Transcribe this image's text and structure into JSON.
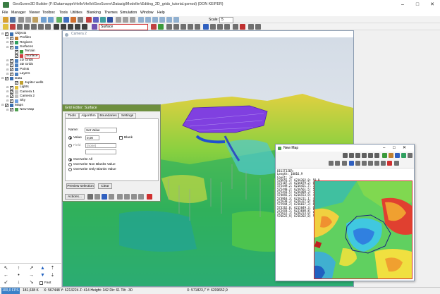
{
  "window": {
    "title": "GeoScene3D Builder (F:\\Datamappe\\Hello\\Hello\\GeoScene\\Datasig\\Modeller\\Editing_2D_grids_tutorial.gsmod) (DON KEIFER)",
    "controls": [
      "–",
      "□",
      "✕"
    ]
  },
  "menu": [
    "File",
    "Manager",
    "Viewer",
    "Toolbox",
    "Tools",
    "Utilities",
    "Blanking",
    "Themes",
    "Simulation",
    "Window",
    "Help"
  ],
  "toolbar": {
    "scale_label": "Scale:",
    "scale_value": "5",
    "surface_select": "Surface"
  },
  "tree": [
    {
      "label": "Objects",
      "level": 0,
      "checked": true,
      "icon_color": "#3a6fb0"
    },
    {
      "label": "Profiles",
      "level": 1,
      "checked": true,
      "icon_color": "#c08030"
    },
    {
      "label": "Regions",
      "level": 1,
      "checked": true,
      "icon_color": "#30a060"
    },
    {
      "label": "Surfaces",
      "level": 1,
      "checked": true,
      "icon_color": "#4a80c0"
    },
    {
      "label": "Terrain",
      "level": 2,
      "checked": true,
      "icon_color": "#3a9a3a"
    },
    {
      "label": "Surface",
      "level": 2,
      "checked": true,
      "icon_color": "#d04040",
      "highlight": true
    },
    {
      "label": "2D Grids",
      "level": 1,
      "checked": true,
      "icon_color": "#4a80c0"
    },
    {
      "label": "3D Grids",
      "level": 1,
      "checked": true,
      "icon_color": "#4a80c0"
    },
    {
      "label": "Points",
      "level": 1,
      "checked": true,
      "icon_color": "#4a80c0"
    },
    {
      "label": "Layers",
      "level": 1,
      "checked": true,
      "icon_color": "#4a80c0"
    },
    {
      "label": "Data",
      "level": 0,
      "checked": true,
      "icon_color": "#3a6fb0"
    },
    {
      "label": "Jupiter wells",
      "level": 2,
      "checked": true,
      "icon_color": "#c0a030"
    },
    {
      "label": "Lights",
      "level": 1,
      "checked": true,
      "icon_color": "#e0c040"
    },
    {
      "label": "Camera 1",
      "level": 1,
      "checked": true,
      "icon_color": "#c0c0c0"
    },
    {
      "label": "Camera 2",
      "level": 1,
      "checked": true,
      "icon_color": "#c0c0c0"
    },
    {
      "label": "Sky",
      "level": 1,
      "checked": true,
      "icon_color": "#70a0e0"
    },
    {
      "label": "Maps",
      "level": 0,
      "checked": true,
      "icon_color": "#3a6fb0"
    },
    {
      "label": "New Map",
      "level": 1,
      "checked": true,
      "icon_color": "#50a050"
    }
  ],
  "camera": {
    "title": "Camera 2"
  },
  "grid_editor": {
    "title": "Grid Editor: Surface",
    "tabs": [
      "Tools",
      "Algorithm",
      "Boundaries",
      "Settings"
    ],
    "active_tab": "Algorithm",
    "name_label": "Name:",
    "name_value": "Set Value",
    "value_label": "Value",
    "value_input": "0,00",
    "blank_label": "Blank",
    "field_label": "Field",
    "field_value": "(none)",
    "overwrite_options": [
      "Overwrite All",
      "Overwrite Non Blanks Value",
      "Overwrite Only Blanks Value"
    ],
    "preview_button": "Preview selection",
    "clear_button": "Clear",
    "actions_button": "Actions..."
  },
  "new_map": {
    "title": "New Map",
    "info_lines": [
      "DIGITIZER:",
      "Length: 10016,9",
      "Count:  13",
      "576655,2; 6216202,8;  59,9",
      "575107,3; 6216079,2;  64,6",
      "575449,2; 6216451,7;  72,7",
      "575440,2; 6216561,5;  52,6",
      "575443,5; 6216489,3;  70,9",
      "574892,2; 6216553,9;  47,2",
      "573863,3; 6216211,1;  47,2",
      "572638,3; 6216327,8;  61,6",
      "572944,2; 6216037,3;  65,4",
      "573262,8; 6215849,3;  68,0",
      "575443,5; 6215830,8;  56,1",
      "575612,3; 6216223,0;  50,9",
      "576622,9; 6216202,8;  59,9"
    ]
  },
  "status": {
    "fps": "100,0 FPS",
    "memory": "181,638 K",
    "coords_left": "X: 567448  Y: 6213224  Z: 414  Height: 342  Dir: 61  Tilt: -30",
    "coords_right": "X: 571823,7  Y: 6209652,9"
  },
  "nav": {
    "fast_label": "Fast"
  },
  "colors": {
    "accent_title": "#6e8f3f",
    "highlight": "#d03030"
  }
}
